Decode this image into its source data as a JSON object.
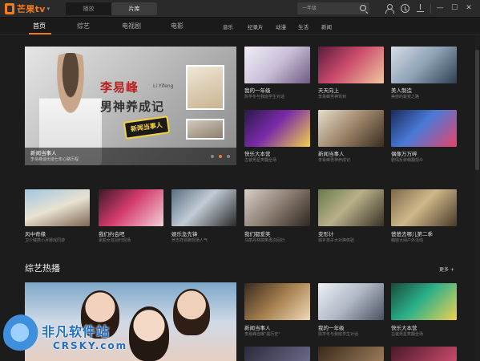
{
  "app": {
    "logo_text": "芒果tv",
    "logo_caret": "▾"
  },
  "modes": [
    "播放",
    "片库"
  ],
  "search": {
    "placeholder": "一年级"
  },
  "window": {
    "minimize": "—",
    "maximize": "☐",
    "close": "✕"
  },
  "nav": {
    "main": [
      "首页",
      "综艺",
      "电视剧",
      "电影"
    ],
    "secondary": [
      "音乐",
      "纪录片",
      "动漫",
      "生活",
      "新闻"
    ]
  },
  "banner": {
    "title_line1": "李易峰",
    "title_line1_en": "Li Yifeng",
    "title_line2": "男神养成记",
    "sticker": "新闻当事人",
    "caption": "新闻当事人",
    "sub": "李易峰谈出道七年心路历程"
  },
  "top_grid": [
    {
      "title": "我的一年级",
      "sub": "陈学冬与我班学生对话"
    },
    {
      "title": "天天向上",
      "sub": "李易峰男神驾到"
    },
    {
      "title": "美人制造",
      "sub": "美丽的蜕变之路"
    },
    {
      "title": "快乐大本营",
      "sub": "古装男星笑翻全场"
    },
    {
      "title": "新闻当事人",
      "sub": "李易峰男神养成记"
    },
    {
      "title": "偶像万万碎",
      "sub": "剧情反转萌翻观众"
    }
  ],
  "mid_row": [
    {
      "title": "风中奇缘",
      "sub": "卫少臻携小月嬉戏同游"
    },
    {
      "title": "我们约会吧",
      "sub": "素颜女友回归现场"
    },
    {
      "title": "娱乐急先锋",
      "sub": "罗志祥领跑现场人气"
    },
    {
      "title": "我们都爱笑",
      "sub": "马丽丹林搞笑再次回归"
    },
    {
      "title": "变形计",
      "sub": "城乡孩子大对换体验"
    },
    {
      "title": "爸爸去哪儿第二季",
      "sub": "萌娃大闹户外活动"
    }
  ],
  "section": {
    "title": "综艺热播",
    "more": "更多 +"
  },
  "hot_grid": [
    {
      "title": "新闻当事人",
      "sub": "李易峰自曝\"黑历史\""
    },
    {
      "title": "我的一年级",
      "sub": "陈学冬与我班学生对话"
    },
    {
      "title": "快乐大本营",
      "sub": "古装男星笑翻全场"
    }
  ],
  "watermark": {
    "line1": "非凡软件站",
    "line2": "CRSKY.com"
  },
  "colors": {
    "accent": "#f37b1d",
    "background": "#1c1c1c"
  }
}
